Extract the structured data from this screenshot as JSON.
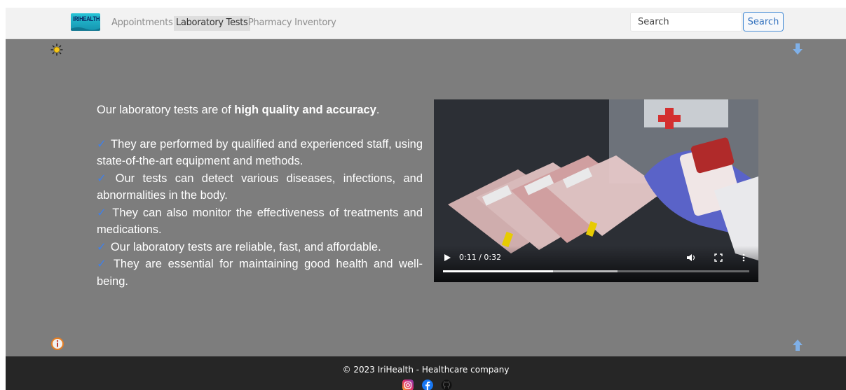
{
  "navbar": {
    "logo_text": "IRIHEALTH",
    "links": [
      {
        "label": "Appointments",
        "active": false
      },
      {
        "label": "Laboratory Tests",
        "active": true
      },
      {
        "label": "Pharmacy Inventory",
        "active": false
      }
    ],
    "search_placeholder": "Search",
    "search_button": "Search"
  },
  "content": {
    "intro_prefix": "Our laboratory tests are of ",
    "intro_bold": "high quality and accuracy",
    "intro_suffix": ".",
    "check_mark": "✓",
    "points": [
      "They are performed by qualified and experienced staff, using state-of-the-art equipment and methods.",
      "Our tests can detect various diseases, infections, and abnormalities in the body.",
      "They can also monitor the effectiveness of treatments and medications.",
      "Our laboratory tests are reliable, fast, and affordable.",
      "They are essential for maintaining good health and well-being."
    ]
  },
  "video": {
    "time_display": "0:11 / 0:32",
    "progress_percent": 36,
    "buffered_percent": 57
  },
  "footer": {
    "copyright": "© 2023 IriHealth - Healthcare company"
  },
  "colors": {
    "main_bg": "#7d7d7d",
    "check_color": "#3f7fe8",
    "footer_bg": "#262626",
    "accent": "#4a8fd6"
  },
  "icons": {
    "top_left": "sun-icon",
    "top_right": "arrow-down-icon",
    "bottom_left": "info-icon",
    "bottom_right": "arrow-up-icon"
  }
}
